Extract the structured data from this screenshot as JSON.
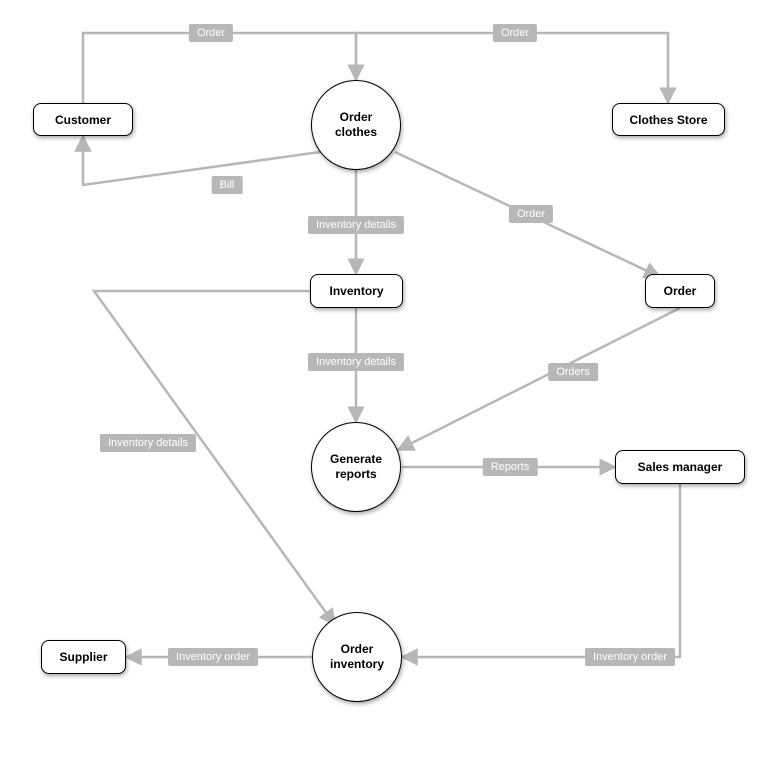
{
  "nodes": {
    "customer": "Customer",
    "order_clothes": "Order\nclothes",
    "clothes_store": "Clothes Store",
    "inventory": "Inventory",
    "order": "Order",
    "generate_reports": "Generate\nreports",
    "sales_manager": "Sales manager",
    "order_inventory": "Order\ninventory",
    "supplier": "Supplier"
  },
  "edges": {
    "cust_to_oc": "Order",
    "oc_to_store": "Order",
    "oc_to_cust_bill": "Bill",
    "oc_to_inv": "Inventory details",
    "oc_to_order": "Order",
    "inv_to_gen": "Inventory details",
    "order_to_gen": "Orders",
    "gen_to_sales": "Reports",
    "sales_to_oi": "Inventory order",
    "oi_to_supplier": "Inventory order",
    "inv_to_oi": "Inventory details"
  }
}
